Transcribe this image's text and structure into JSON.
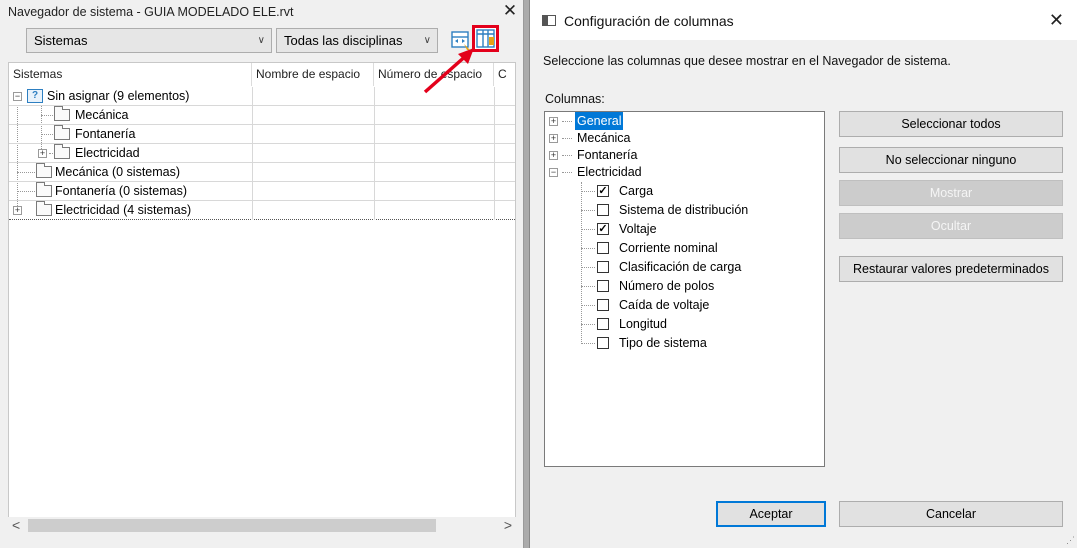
{
  "browser": {
    "title": "Navegador de sistema - GUIA MODELADO ELE.rvt",
    "close_glyph": "✕",
    "systems_combo": "Sistemas",
    "disciplines_combo": "Todas las disciplinas",
    "columns": [
      "Sistemas",
      "Nombre de espacio",
      "Número de espacio",
      "C"
    ],
    "rows": [
      {
        "label": "Sin asignar (9 elementos)",
        "level": 0,
        "expander": "−",
        "unknown_icon": true
      },
      {
        "label": "Mecánica",
        "level": 1
      },
      {
        "label": "Fontanería",
        "level": 1
      },
      {
        "label": "Electricidad",
        "level": 1,
        "expander": "+"
      },
      {
        "label": "Mecánica (0 sistemas)",
        "level": 0
      },
      {
        "label": "Fontanería (0 sistemas)",
        "level": 0
      },
      {
        "label": "Electricidad (4 sistemas)",
        "level": 0,
        "expander": "+"
      }
    ],
    "scroll_left": "<",
    "scroll_right": ">",
    "highlight_color": "#e3001b"
  },
  "dialog": {
    "title": "Configuración de columnas",
    "close_glyph": "✕",
    "instruction": "Seleccione las columnas que desee mostrar en el Navegador de sistema.",
    "columns_label": "Columnas:",
    "tree": [
      {
        "label": "General",
        "expander": "+",
        "selected": true
      },
      {
        "label": "Mecánica",
        "expander": "+"
      },
      {
        "label": "Fontanería",
        "expander": "+"
      },
      {
        "label": "Electricidad",
        "expander": "−"
      }
    ],
    "electric_items": [
      {
        "label": "Carga",
        "checked": true
      },
      {
        "label": "Sistema de distribución",
        "checked": false
      },
      {
        "label": "Voltaje",
        "checked": true
      },
      {
        "label": "Corriente nominal",
        "checked": false
      },
      {
        "label": "Clasificación de carga",
        "checked": false
      },
      {
        "label": "Número de polos",
        "checked": false
      },
      {
        "label": "Caída de voltaje",
        "checked": false
      },
      {
        "label": "Longitud",
        "checked": false
      },
      {
        "label": "Tipo de sistema",
        "checked": false
      }
    ],
    "buttons": {
      "select_all": "Seleccionar todos",
      "select_none": "No seleccionar ninguno",
      "show": "Mostrar",
      "hide": "Ocultar",
      "restore": "Restaurar valores predeterminados",
      "accept": "Aceptar",
      "cancel": "Cancelar"
    },
    "accent_color": "#0078d7"
  }
}
